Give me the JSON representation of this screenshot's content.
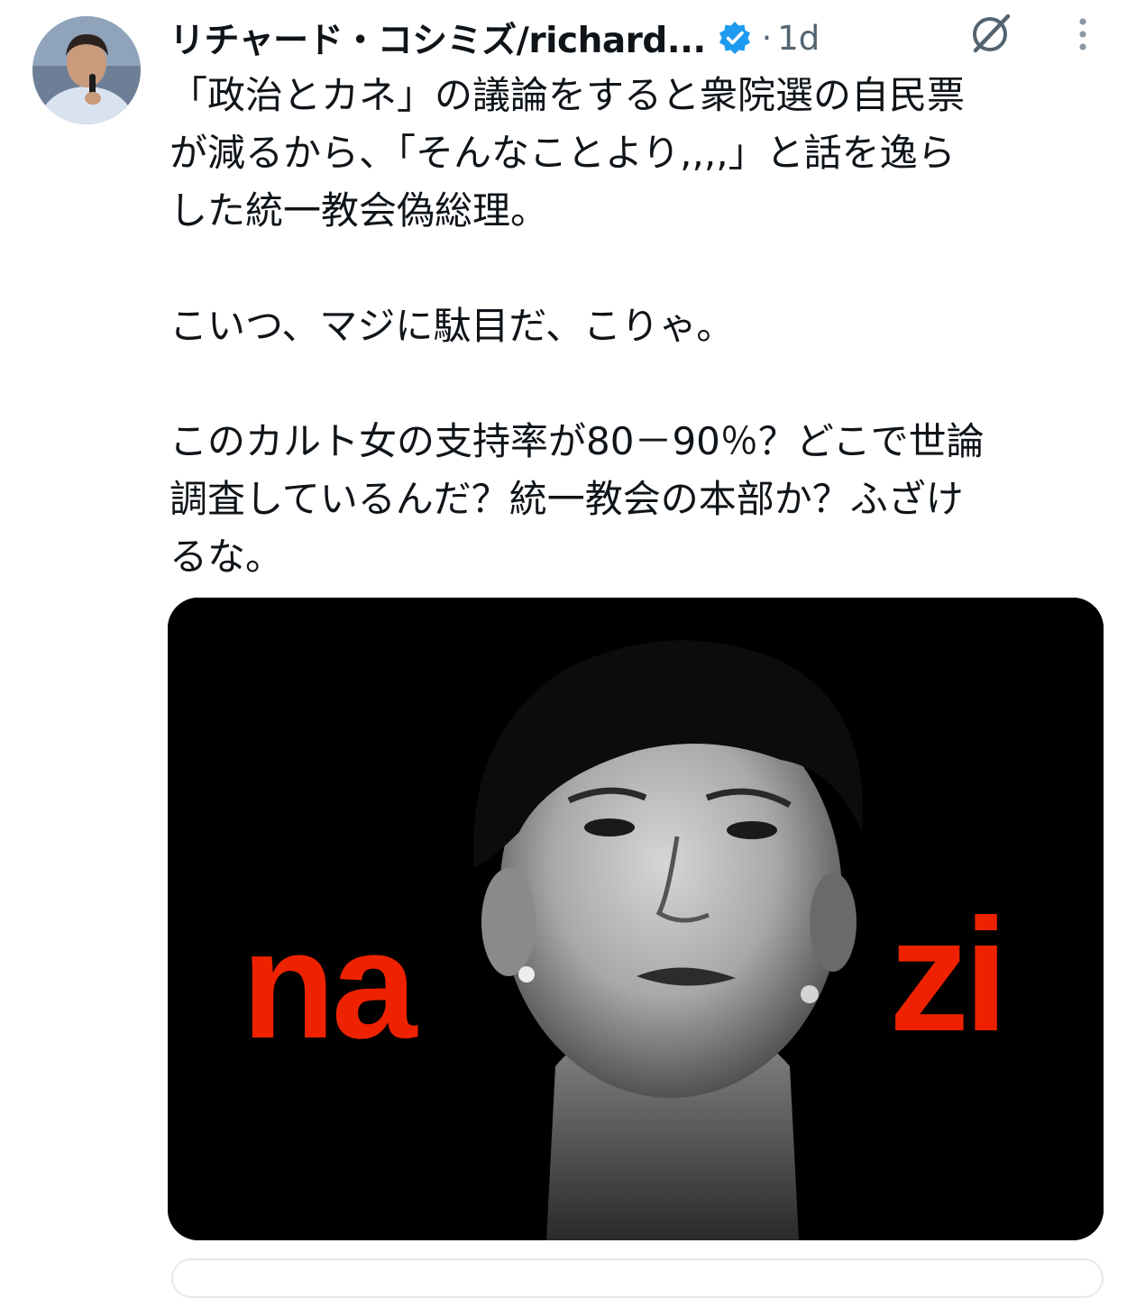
{
  "tweet": {
    "author": {
      "display_name": "リチャード・コシミズ/richard...",
      "verified": true,
      "verified_color": "#1d9bf0"
    },
    "separator": "·",
    "timestamp": "1d",
    "icons": {
      "grok": "grok-icon",
      "more": "more-vertical-icon",
      "verified": "verified-badge-icon"
    },
    "text": {
      "paragraph1": "「政治とカネ」の議論をすると衆院選の自民票\nが減るから、「そんなことより,,,,」と話を逸ら\nした統一教会偽総理。",
      "paragraph2": "こいつ、マジに駄目だ、こりゃ。",
      "paragraph3": "このカルト女の支持率が80－90％？どこで世論\n調査しているんだ？統一教会の本部か？ふざけ\nるな。"
    },
    "media": {
      "overlay_left": "na",
      "overlay_right": "zi",
      "overlay_color": "#ee2200",
      "background": "#000000"
    },
    "colors": {
      "text": "#0f1419",
      "secondary": "#536471"
    }
  }
}
